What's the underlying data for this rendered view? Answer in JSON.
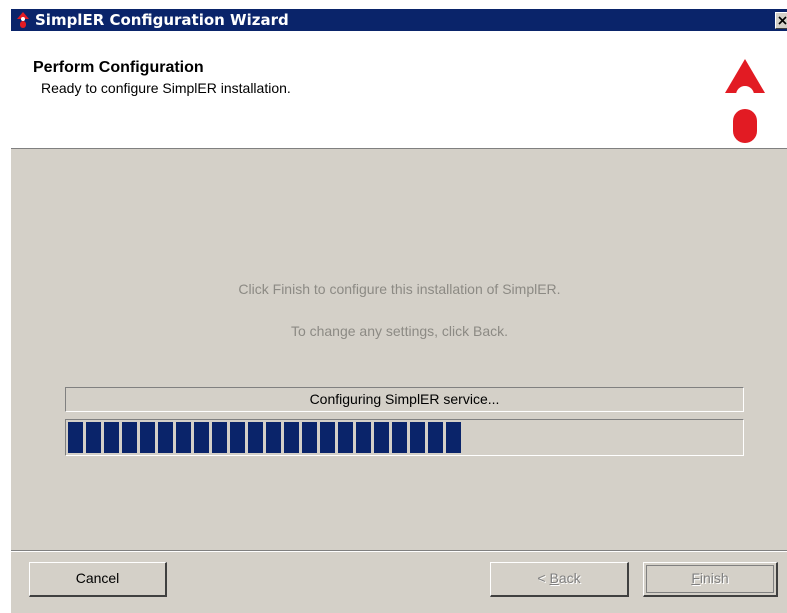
{
  "window": {
    "title": "SimplER Configuration Wizard",
    "title_bar_color": "#0a246a",
    "icons": [
      "app-logo-icon",
      "close-icon"
    ]
  },
  "header": {
    "title": "Perform Configuration",
    "subtitle": "Ready to configure SimplER installation."
  },
  "body": {
    "line1": "Click Finish to configure this installation of SimplER.",
    "line2": "To change any settings, click Back."
  },
  "progress": {
    "status": "Configuring SimplER service...",
    "fraction": 0.6,
    "bar_color": "#0a246a"
  },
  "buttons": {
    "cancel": "Cancel",
    "back_mnemonic": "B",
    "back_rest": "ack",
    "back_arrow": "<",
    "finish_mnemonic": "F",
    "finish_rest": "inish"
  },
  "colors": {
    "brand_red": "#e21b23",
    "dialog_bg": "#d4d0c8"
  }
}
